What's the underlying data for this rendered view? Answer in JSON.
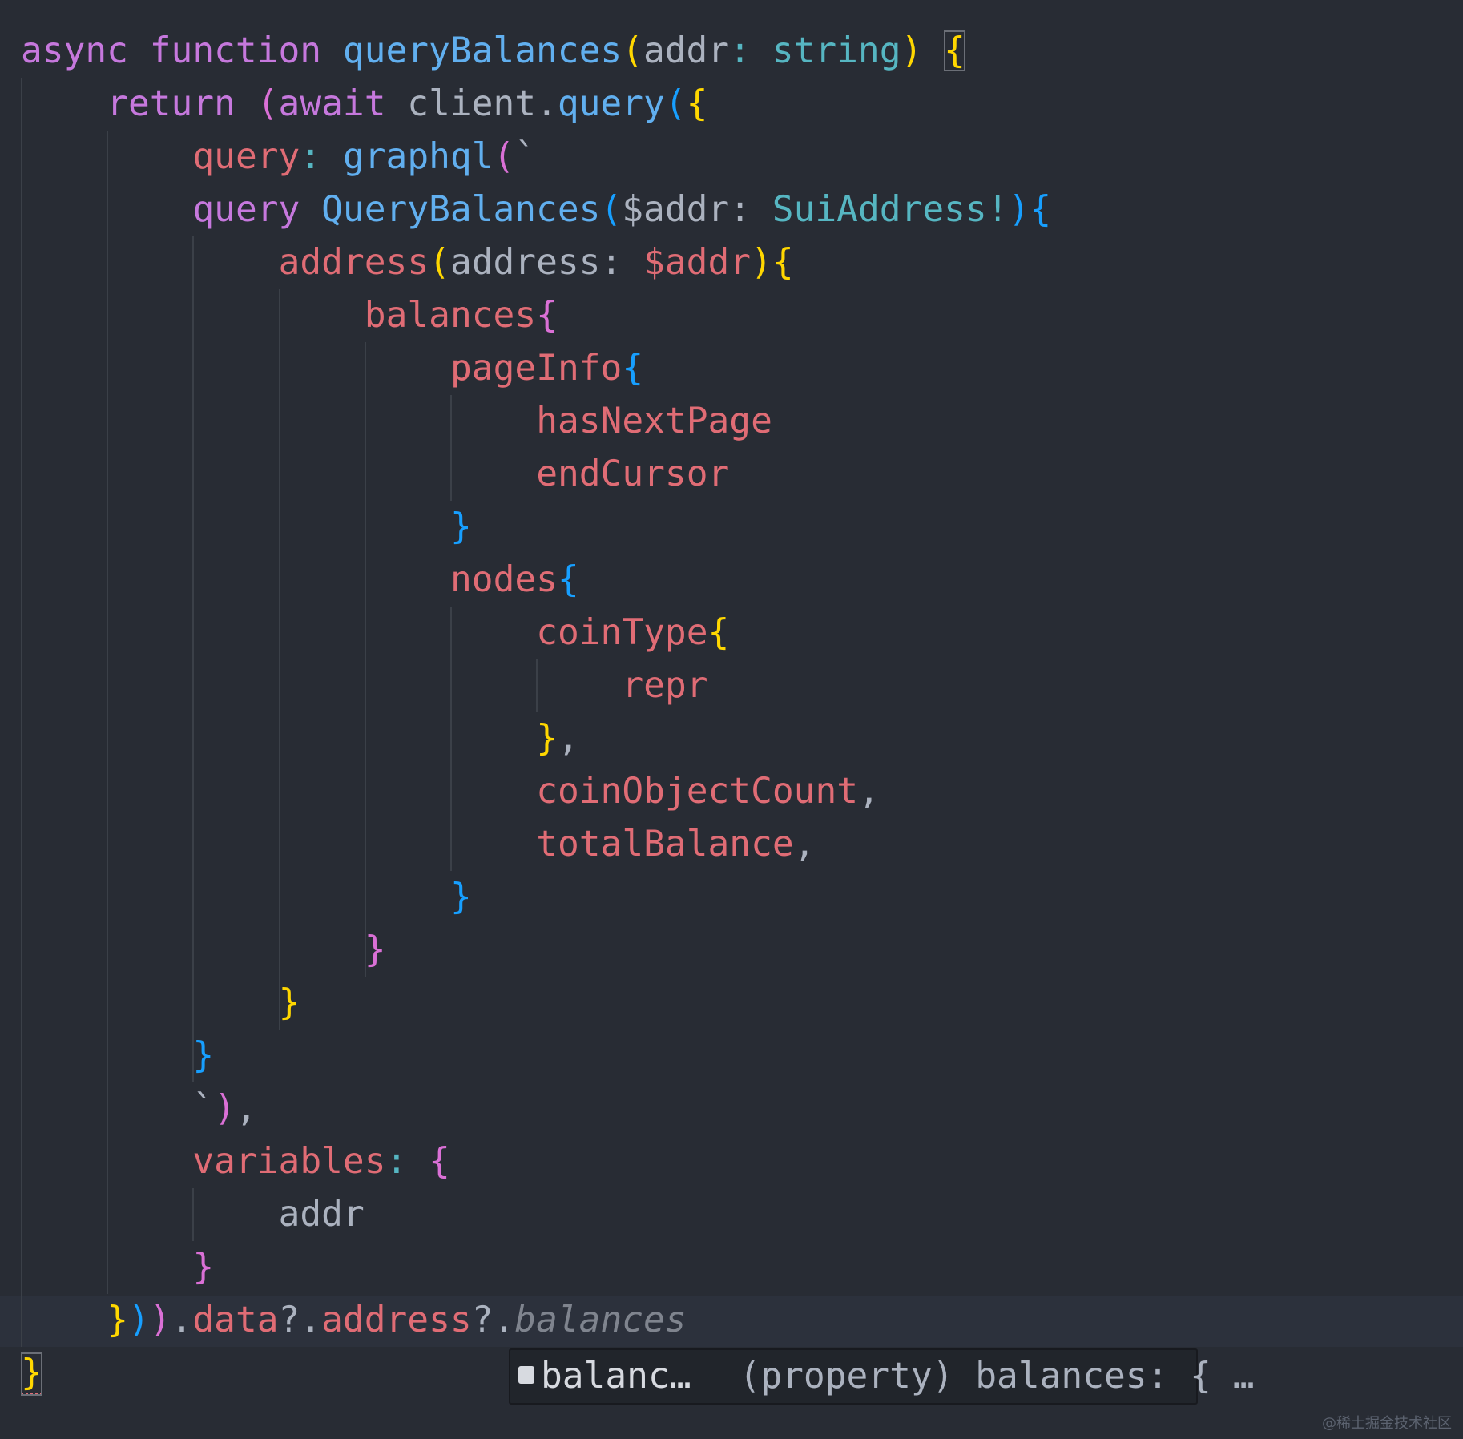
{
  "editor": {
    "lines": [
      {
        "indent": 0,
        "tokens": [
          [
            "async ",
            "kw"
          ],
          [
            "function ",
            "kw"
          ],
          [
            "queryBalances",
            "fn"
          ],
          [
            "(",
            "b1"
          ],
          [
            "addr",
            "tx"
          ],
          [
            ": ",
            "ty"
          ],
          [
            "string",
            "ty"
          ],
          [
            ")",
            "b1"
          ],
          [
            " ",
            "tx"
          ],
          [
            "{",
            "b1 boxed"
          ]
        ]
      },
      {
        "indent": 1,
        "tokens": [
          [
            "return ",
            "kw"
          ],
          [
            "(",
            "b2"
          ],
          [
            "await ",
            "kw"
          ],
          [
            "client",
            "tx"
          ],
          [
            ".",
            "tx"
          ],
          [
            "query",
            "fn"
          ],
          [
            "(",
            "b3"
          ],
          [
            "{",
            "b1"
          ]
        ]
      },
      {
        "indent": 2,
        "tokens": [
          [
            "query",
            "pr"
          ],
          [
            ": ",
            "ty"
          ],
          [
            "graphql",
            "fn"
          ],
          [
            "(",
            "b2"
          ],
          [
            "`",
            "tx"
          ]
        ]
      },
      {
        "indent": 2,
        "tokens": [
          [
            "query ",
            "kw"
          ],
          [
            "QueryBalances",
            "fn"
          ],
          [
            "(",
            "b3"
          ],
          [
            "$addr",
            "tx"
          ],
          [
            ": ",
            "tx"
          ],
          [
            "SuiAddress!",
            "ty"
          ],
          [
            ")",
            "b3"
          ],
          [
            "{",
            "b3"
          ]
        ]
      },
      {
        "indent": 3,
        "tokens": [
          [
            "address",
            "pr"
          ],
          [
            "(",
            "b1"
          ],
          [
            "address",
            "tx"
          ],
          [
            ": ",
            "tx"
          ],
          [
            "$addr",
            "pr"
          ],
          [
            ")",
            "b1"
          ],
          [
            "{",
            "b1"
          ]
        ]
      },
      {
        "indent": 4,
        "tokens": [
          [
            "balances",
            "pr"
          ],
          [
            "{",
            "b2"
          ]
        ]
      },
      {
        "indent": 5,
        "tokens": [
          [
            "pageInfo",
            "pr"
          ],
          [
            "{",
            "b3"
          ]
        ]
      },
      {
        "indent": 6,
        "tokens": [
          [
            "hasNextPage",
            "pr"
          ]
        ]
      },
      {
        "indent": 6,
        "tokens": [
          [
            "endCursor",
            "pr"
          ]
        ]
      },
      {
        "indent": 5,
        "tokens": [
          [
            "}",
            "b3"
          ]
        ]
      },
      {
        "indent": 5,
        "tokens": [
          [
            "nodes",
            "pr"
          ],
          [
            "{",
            "b3"
          ]
        ]
      },
      {
        "indent": 6,
        "tokens": [
          [
            "coinType",
            "pr"
          ],
          [
            "{",
            "b1"
          ]
        ]
      },
      {
        "indent": 7,
        "tokens": [
          [
            "repr",
            "pr"
          ]
        ]
      },
      {
        "indent": 6,
        "tokens": [
          [
            "}",
            "b1"
          ],
          [
            ",",
            "tx"
          ]
        ]
      },
      {
        "indent": 6,
        "tokens": [
          [
            "coinObjectCount",
            "pr"
          ],
          [
            ",",
            "tx"
          ]
        ]
      },
      {
        "indent": 6,
        "tokens": [
          [
            "totalBalance",
            "pr"
          ],
          [
            ",",
            "tx"
          ]
        ]
      },
      {
        "indent": 5,
        "tokens": [
          [
            "}",
            "b3"
          ]
        ]
      },
      {
        "indent": 4,
        "tokens": [
          [
            "}",
            "b2"
          ]
        ]
      },
      {
        "indent": 3,
        "tokens": [
          [
            "}",
            "b1"
          ]
        ]
      },
      {
        "indent": 2,
        "tokens": [
          [
            "}",
            "b3"
          ]
        ]
      },
      {
        "indent": 2,
        "tokens": [
          [
            "`",
            "tx"
          ],
          [
            ")",
            "b2"
          ],
          [
            ",",
            "tx"
          ]
        ]
      },
      {
        "indent": 2,
        "tokens": [
          [
            "variables",
            "pr"
          ],
          [
            ": ",
            "ty"
          ],
          [
            "{",
            "b2"
          ]
        ]
      },
      {
        "indent": 3,
        "tokens": [
          [
            "addr",
            "tx"
          ]
        ]
      },
      {
        "indent": 2,
        "tokens": [
          [
            "}",
            "b2"
          ]
        ]
      },
      {
        "indent": 1,
        "tokens": [
          [
            "}",
            "b1"
          ],
          [
            ")",
            "b3"
          ],
          [
            ")",
            "b2"
          ],
          [
            ".",
            "tx"
          ],
          [
            "data",
            "pr"
          ],
          [
            "?.",
            "tx"
          ],
          [
            "address",
            "pr"
          ],
          [
            "?.",
            "tx"
          ],
          [
            "balances",
            "it"
          ]
        ]
      },
      {
        "indent": 0,
        "tokens": [
          [
            "}",
            "b1 boxed squig"
          ]
        ]
      }
    ]
  },
  "hover": {
    "icon": "property-icon",
    "name": "balanc…",
    "description": "(property) balances: { …"
  },
  "watermark": "@稀土掘金技术社区",
  "colors": {
    "background": "#282c34",
    "keyword": "#c678dd",
    "function": "#61afef",
    "type": "#56b6c2",
    "property": "#e06c75",
    "bracket1": "#ffd700",
    "bracket2": "#da70d6",
    "bracket3": "#179fff"
  }
}
